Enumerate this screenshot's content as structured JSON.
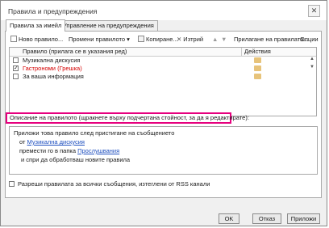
{
  "window": {
    "title": "Правила и предупреждения",
    "close_glyph": "✕"
  },
  "tabs": [
    {
      "label": "Правила за имейл"
    },
    {
      "label": "Управление на предупреждения"
    }
  ],
  "toolbar": {
    "new_rule": "Ново правило...",
    "change_rule": "Промени правилото",
    "dropdown_glyph": "▾",
    "copy": "Копиране...",
    "delete_glyph": "✕",
    "delete": "Изтрий",
    "up_glyph": "▲",
    "down_glyph": "▼",
    "run_rules": "Прилагане на правилата...",
    "options": "Опции"
  },
  "rules_table": {
    "columns": [
      "Правило (прилага се в указания ред)",
      "Действия"
    ],
    "rows": [
      {
        "name": "Музикална дискусия",
        "checked": false,
        "color": "#1a1a1a"
      },
      {
        "name": "Гастрономи (Грешка)",
        "checked": true,
        "color": "#d40000"
      },
      {
        "name": "За ваша информация",
        "checked": false,
        "color": "#1a1a1a"
      }
    ],
    "scroll_up_glyph": "▲",
    "scroll_down_glyph": "▼"
  },
  "description": {
    "label": "Описание на правилото (щракнете върху подчертана стойност, за да я редактирате):",
    "line1": "Приложи това правило след пристигане на съобщението",
    "line2_prefix": "от",
    "line2_link": "Музикална дискусия",
    "line3_prefix": "премести го в папка",
    "line3_link": "Прослушвания",
    "line4": "и спри да обработваш новите правила"
  },
  "rss": {
    "label": "Разреши правилата за всички съобщения, изтеглени от RSS канали"
  },
  "buttons": {
    "ok": "OK",
    "cancel": "Отказ",
    "apply": "Приложи"
  },
  "colors": {
    "highlight_border": "#e6007e",
    "link": "#1e4fbf",
    "error_rule": "#d40000"
  }
}
